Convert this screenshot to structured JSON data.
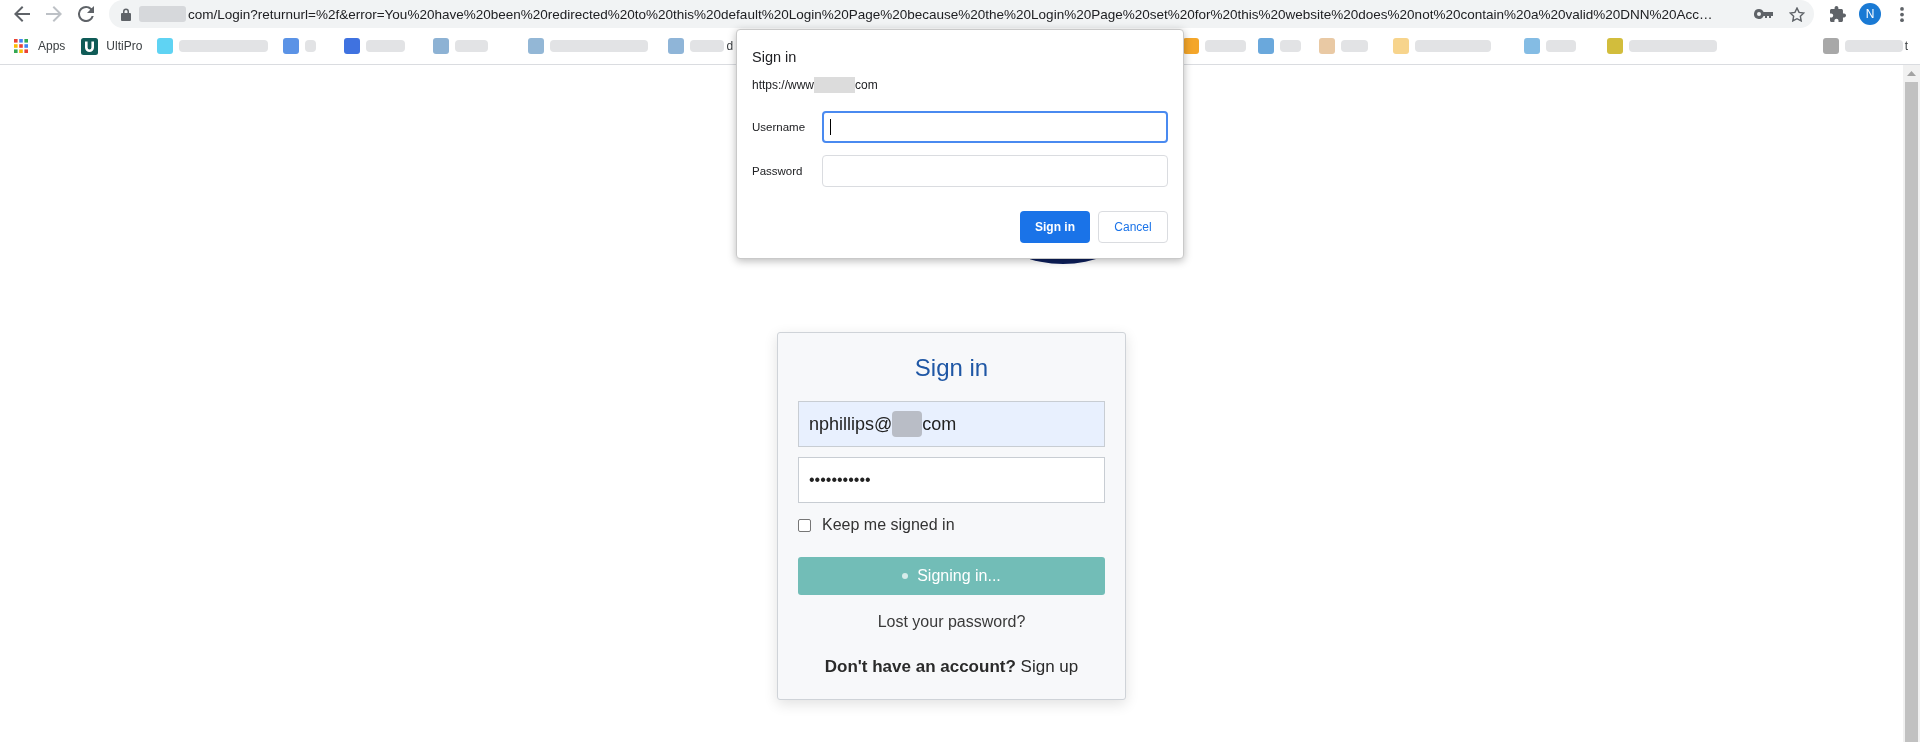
{
  "browser": {
    "nav": [
      {
        "kind": "back",
        "disabled": false
      },
      {
        "kind": "forward",
        "disabled": true
      },
      {
        "kind": "reload",
        "disabled": false
      }
    ],
    "address": {
      "parts": [
        {
          "kind": "redacted"
        },
        {
          "kind": "text",
          "text": "com/Login?returnurl=%2f&error=You%20have%20been%20redirected%20to%20this%20default%20Login%20Page%20because%20the%20Login%20Page%20set%20for%20this%20website%20does%20not%20contain%20a%20valid%20DNN%20Acc…"
        }
      ]
    },
    "profile": {
      "initial": "N"
    },
    "bookmarks": [
      {
        "kind": "apps",
        "label": "Apps"
      },
      {
        "kind": "favicon",
        "label": "UltiPro"
      },
      {
        "kind": "redacted",
        "color": "#5fd3f3"
      },
      {
        "kind": "redacted",
        "color": "#5b93e6"
      },
      {
        "kind": "redacted",
        "color": "#3f72e0"
      },
      {
        "kind": "redacted",
        "color": "#8db2d4"
      },
      {
        "kind": "redacted",
        "color": "#93b7d6"
      },
      {
        "kind": "redacted",
        "color": "#8fb5d8",
        "label": "d"
      },
      {
        "kind": "redacted",
        "color": "#f4a62a"
      },
      {
        "kind": "redacted",
        "color": "#6aa8dc"
      },
      {
        "kind": "redacted",
        "color": "#e9c9a4"
      },
      {
        "kind": "redacted",
        "color": "#f7d48c"
      },
      {
        "kind": "redacted",
        "color": "#84bce4"
      },
      {
        "kind": "redacted",
        "color": "#d2bd3c"
      },
      {
        "kind": "redacted",
        "color": "#a8a8a8",
        "label": "t"
      }
    ]
  },
  "dialog": {
    "title": "Sign in",
    "origin": [
      {
        "kind": "text",
        "text": "https://www"
      },
      {
        "kind": "redacted"
      },
      {
        "kind": "text",
        "text": "com"
      }
    ],
    "fields": [
      {
        "label": "Username",
        "focused": true
      },
      {
        "label": "Password",
        "focused": false
      }
    ],
    "buttons": [
      {
        "kind": "primary",
        "label": "Sign in"
      },
      {
        "kind": "secondary",
        "label": "Cancel"
      }
    ]
  },
  "login_card": {
    "title": "Sign in",
    "email": {
      "parts": [
        {
          "kind": "text",
          "text": "nphillips@"
        },
        {
          "kind": "redacted"
        },
        {
          "kind": "text",
          "text": "com"
        }
      ],
      "autofilled": true
    },
    "password": {
      "value": "•••••••••••"
    },
    "keep_signed_in": {
      "label": "Keep me signed in",
      "checked": false
    },
    "submit": {
      "label": "Signing in...",
      "busy": true
    },
    "forgot_link": "Lost your password?",
    "signup_prompt": "Don't have an account?",
    "signup_link": "Sign up"
  }
}
